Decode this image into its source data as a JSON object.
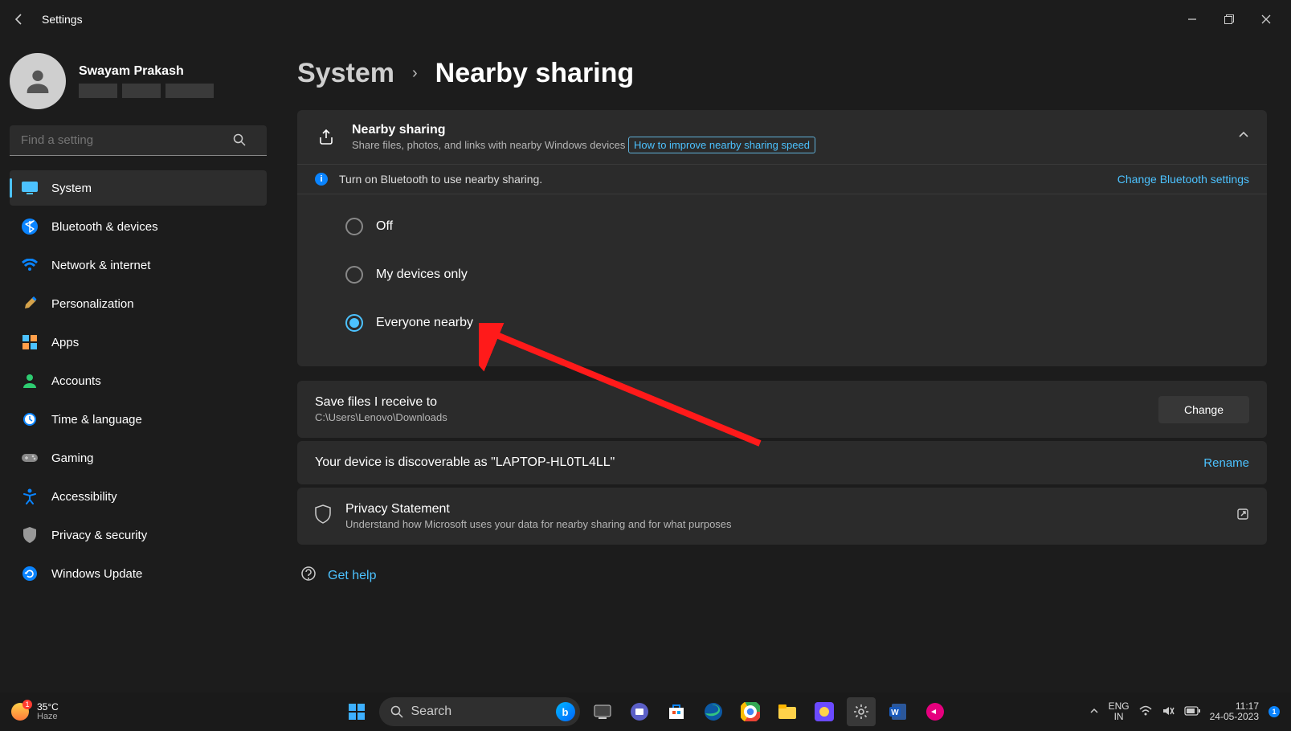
{
  "window": {
    "app_title": "Settings"
  },
  "user": {
    "name": "Swayam Prakash"
  },
  "search": {
    "placeholder": "Find a setting"
  },
  "nav": [
    {
      "id": "system",
      "label": "System",
      "active": true
    },
    {
      "id": "bluetooth",
      "label": "Bluetooth & devices"
    },
    {
      "id": "network",
      "label": "Network & internet"
    },
    {
      "id": "personalization",
      "label": "Personalization"
    },
    {
      "id": "apps",
      "label": "Apps"
    },
    {
      "id": "accounts",
      "label": "Accounts"
    },
    {
      "id": "time",
      "label": "Time & language"
    },
    {
      "id": "gaming",
      "label": "Gaming"
    },
    {
      "id": "accessibility",
      "label": "Accessibility"
    },
    {
      "id": "privacy",
      "label": "Privacy & security"
    },
    {
      "id": "update",
      "label": "Windows Update"
    }
  ],
  "breadcrumb": {
    "parent": "System",
    "current": "Nearby sharing"
  },
  "nearby_card": {
    "title": "Nearby sharing",
    "subtitle": "Share files, photos, and links with nearby Windows devices",
    "link": "How to improve nearby sharing speed",
    "info": "Turn on Bluetooth to use nearby sharing.",
    "info_action": "Change Bluetooth settings",
    "options": {
      "off": "Off",
      "mine": "My devices only",
      "everyone": "Everyone nearby"
    },
    "selected": "everyone"
  },
  "save_row": {
    "title": "Save files I receive to",
    "path": "C:\\Users\\Lenovo\\Downloads",
    "button": "Change"
  },
  "device_row": {
    "text": "Your device is discoverable as \"LAPTOP-HL0TL4LL\"",
    "action": "Rename"
  },
  "privacy_row": {
    "title": "Privacy Statement",
    "subtitle": "Understand how Microsoft uses your data for nearby sharing and for what purposes"
  },
  "help": {
    "label": "Get help"
  },
  "taskbar": {
    "weather_temp": "35°C",
    "weather_cond": "Haze",
    "search_placeholder": "Search",
    "lang_top": "ENG",
    "lang_bottom": "IN",
    "time": "11:17",
    "date": "24-05-2023"
  }
}
